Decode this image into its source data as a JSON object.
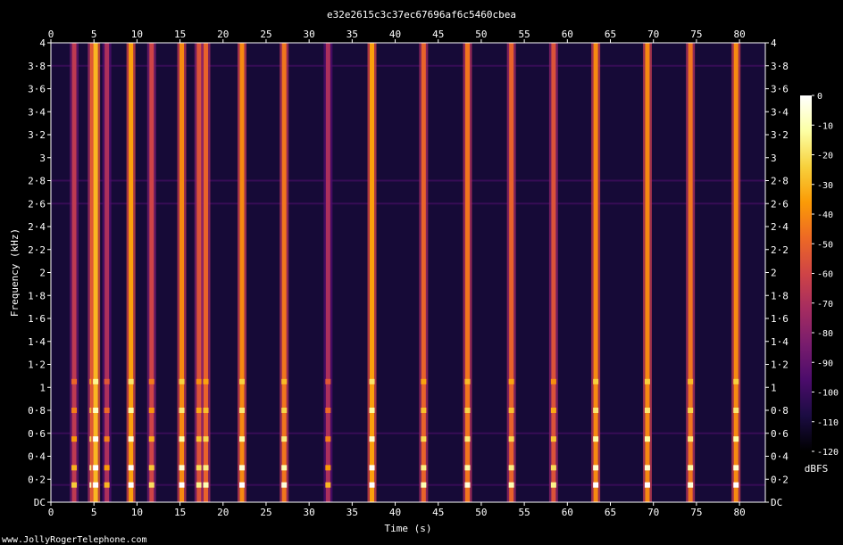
{
  "title": "e32e2615c3c37ec67696af6c5460cbea",
  "watermark": "www.JollyRogerTelephone.com",
  "chart_data": {
    "type": "heatmap",
    "title": "e32e2615c3c37ec67696af6c5460cbea",
    "xlabel": "Time (s)",
    "ylabel": "Frequency (kHz)",
    "xlim": [
      0,
      83
    ],
    "ylim": [
      0,
      4
    ],
    "x_ticks": [
      0,
      5,
      10,
      15,
      20,
      25,
      30,
      35,
      40,
      45,
      50,
      55,
      60,
      65,
      70,
      75,
      80
    ],
    "y_ticks": [
      {
        "value": 0,
        "label": "DC"
      },
      {
        "value": 0.2,
        "label": "0·2"
      },
      {
        "value": 0.4,
        "label": "0·4"
      },
      {
        "value": 0.6,
        "label": "0·6"
      },
      {
        "value": 0.8,
        "label": "0·8"
      },
      {
        "value": 1.0,
        "label": "1"
      },
      {
        "value": 1.2,
        "label": "1·2"
      },
      {
        "value": 1.4,
        "label": "1·4"
      },
      {
        "value": 1.6,
        "label": "1·6"
      },
      {
        "value": 1.8,
        "label": "1·8"
      },
      {
        "value": 2.0,
        "label": "2"
      },
      {
        "value": 2.2,
        "label": "2·2"
      },
      {
        "value": 2.4,
        "label": "2·4"
      },
      {
        "value": 2.6,
        "label": "2·6"
      },
      {
        "value": 2.8,
        "label": "2·8"
      },
      {
        "value": 3.0,
        "label": "3"
      },
      {
        "value": 3.2,
        "label": "3·2"
      },
      {
        "value": 3.4,
        "label": "3·4"
      },
      {
        "value": 3.6,
        "label": "3·6"
      },
      {
        "value": 3.8,
        "label": "3·8"
      },
      {
        "value": 4.0,
        "label": "4"
      }
    ],
    "colorbar": {
      "label": "dBFS",
      "range": [
        -120,
        0
      ],
      "ticks": [
        0,
        -10,
        -20,
        -30,
        -40,
        -50,
        -60,
        -70,
        -80,
        -90,
        -100,
        -110,
        -120
      ],
      "colors": [
        "#000000",
        "#1b0c42",
        "#4b0c6b",
        "#781c6d",
        "#a52c60",
        "#cf4446",
        "#ed6925",
        "#fb9b06",
        "#f7d13d",
        "#fcffa4",
        "#ffffff"
      ]
    },
    "background_level_db": -110,
    "events": [
      {
        "t": 2.7,
        "level": -55
      },
      {
        "t": 4.8,
        "level": -40
      },
      {
        "t": 5.2,
        "level": -20
      },
      {
        "t": 6.5,
        "level": -60
      },
      {
        "t": 9.3,
        "level": -25
      },
      {
        "t": 11.7,
        "level": -50
      },
      {
        "t": 15.2,
        "level": -30
      },
      {
        "t": 17.2,
        "level": -45
      },
      {
        "t": 18.0,
        "level": -40
      },
      {
        "t": 22.2,
        "level": -30
      },
      {
        "t": 27.1,
        "level": -35
      },
      {
        "t": 32.2,
        "level": -60
      },
      {
        "t": 37.3,
        "level": -25
      },
      {
        "t": 43.3,
        "level": -40
      },
      {
        "t": 48.4,
        "level": -35
      },
      {
        "t": 53.5,
        "level": -40
      },
      {
        "t": 58.4,
        "level": -45
      },
      {
        "t": 63.3,
        "level": -30
      },
      {
        "t": 69.3,
        "level": -30
      },
      {
        "t": 74.3,
        "level": -35
      },
      {
        "t": 79.6,
        "level": -30
      }
    ]
  }
}
